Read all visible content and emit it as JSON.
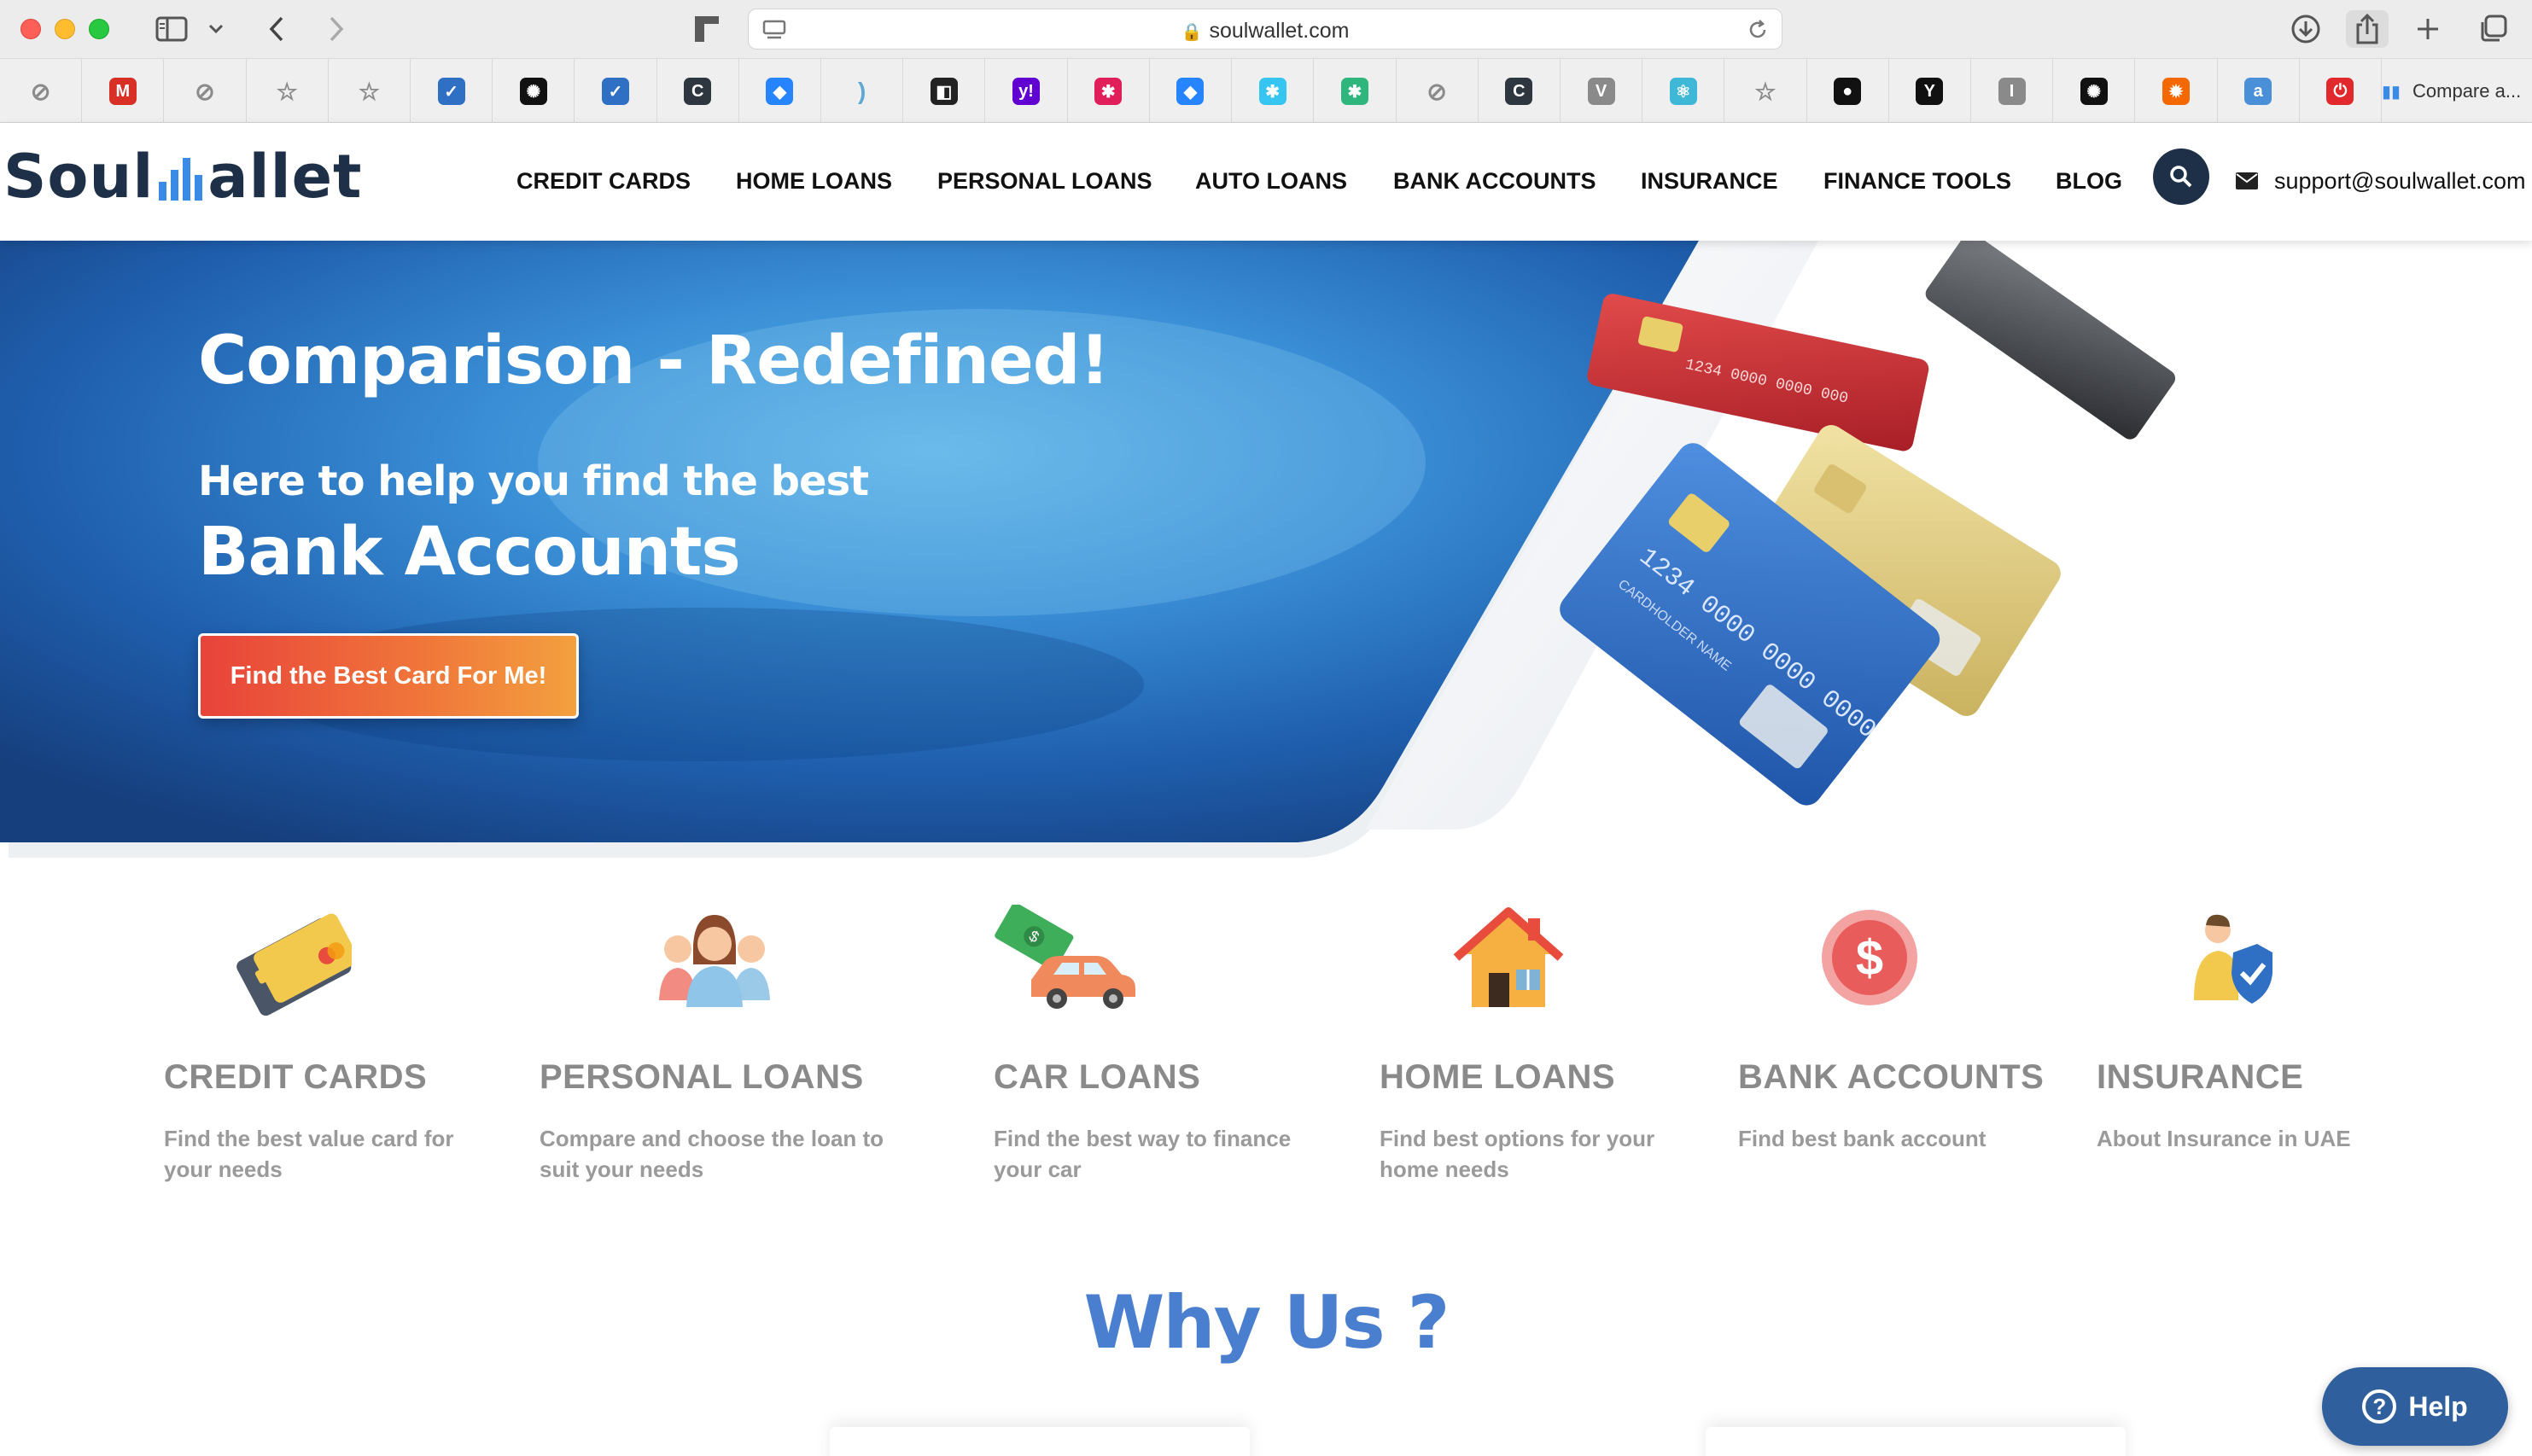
{
  "browser": {
    "url": "soulwallet.com",
    "last_bookmark": "Compare a...",
    "bookmarks": [
      {
        "icon": "safari-compass-icon",
        "color": "#8a8a8a",
        "glyph": "⊘"
      },
      {
        "icon": "gmail-icon",
        "color": "#d93025",
        "glyph": "M"
      },
      {
        "icon": "safari-compass-icon",
        "color": "#8a8a8a",
        "glyph": "⊘"
      },
      {
        "icon": "star-icon",
        "color": "#8a8a8a",
        "glyph": "☆"
      },
      {
        "icon": "star-icon",
        "color": "#8a8a8a",
        "glyph": "☆"
      },
      {
        "icon": "checkbox-app-icon",
        "color": "#2f6fc4",
        "glyph": "✓"
      },
      {
        "icon": "openai-icon",
        "color": "#111111",
        "glyph": "✺"
      },
      {
        "icon": "checkbox-app-icon",
        "color": "#2f6fc4",
        "glyph": "✓"
      },
      {
        "icon": "refresh-app-icon",
        "color": "#2e3640",
        "glyph": "C"
      },
      {
        "icon": "jira-icon",
        "color": "#2684ff",
        "glyph": "◆"
      },
      {
        "icon": "arc-icon",
        "color": "#5fa8d3",
        "glyph": ")"
      },
      {
        "icon": "notion-icon",
        "color": "#222222",
        "glyph": "◧"
      },
      {
        "icon": "yahoo-icon",
        "color": "#6001d2",
        "glyph": "y!"
      },
      {
        "icon": "slack-icon",
        "color": "#e01e5a",
        "glyph": "✱"
      },
      {
        "icon": "jira-icon",
        "color": "#2684ff",
        "glyph": "◆"
      },
      {
        "icon": "slack-icon",
        "color": "#36c5f0",
        "glyph": "✱"
      },
      {
        "icon": "slack-icon",
        "color": "#2eb67d",
        "glyph": "✱"
      },
      {
        "icon": "safari-compass-icon",
        "color": "#8a8a8a",
        "glyph": "⊘"
      },
      {
        "icon": "refresh-app-icon",
        "color": "#2e3640",
        "glyph": "C"
      },
      {
        "icon": "v-app-icon",
        "color": "#8a8a8a",
        "glyph": "V"
      },
      {
        "icon": "react-icon",
        "color": "#3fb7d6",
        "glyph": "⚛"
      },
      {
        "icon": "star-icon",
        "color": "#8a8a8a",
        "glyph": "☆"
      },
      {
        "icon": "github-icon",
        "color": "#111111",
        "glyph": "●"
      },
      {
        "icon": "ycombinator-icon",
        "color": "#111111",
        "glyph": "Y"
      },
      {
        "icon": "i-app-icon",
        "color": "#8a8a8a",
        "glyph": "I"
      },
      {
        "icon": "openai-icon",
        "color": "#111111",
        "glyph": "✺"
      },
      {
        "icon": "grafana-icon",
        "color": "#f46800",
        "glyph": "✹"
      },
      {
        "icon": "aster-icon",
        "color": "#4a90d9",
        "glyph": "a"
      },
      {
        "icon": "power-app-icon",
        "color": "#e0282d",
        "glyph": "⏻"
      }
    ]
  },
  "header": {
    "logo_left": "Soul",
    "logo_right": "allet",
    "nav": [
      "CREDIT CARDS",
      "HOME LOANS",
      "PERSONAL LOANS",
      "AUTO LOANS",
      "BANK ACCOUNTS",
      "INSURANCE",
      "FINANCE TOOLS",
      "BLOG"
    ],
    "email": "support@soulwallet.com"
  },
  "hero": {
    "title": "Comparison - Redefined!",
    "subtitle": "Here to help you find the best",
    "highlight": "Bank Accounts",
    "cta": "Find the Best Card For Me!",
    "card_numbers": [
      "1234 0000 0000 0000",
      "1234 0000 0000 000"
    ],
    "card_holder": "CARDHOLDER NAME"
  },
  "features": [
    {
      "title": "CREDIT CARDS",
      "desc": "Find the best value card for your needs",
      "icon": "credit-cards-icon"
    },
    {
      "title": "PERSONAL LOANS",
      "desc": "Compare and choose the loan to suit your needs",
      "icon": "people-icon"
    },
    {
      "title": "CAR LOANS",
      "desc": "Find the best way to finance your car",
      "icon": "car-money-icon"
    },
    {
      "title": "HOME LOANS",
      "desc": "Find best options for your home needs",
      "icon": "house-icon"
    },
    {
      "title": "BANK ACCOUNTS",
      "desc": "Find best bank account",
      "icon": "dollar-coin-icon"
    },
    {
      "title": "INSURANCE",
      "desc": "About Insurance in UAE",
      "icon": "insurance-shield-icon"
    }
  ],
  "why_us": "Why Us ?",
  "help_label": "Help",
  "colors": {
    "brand_navy": "#1e3048",
    "brand_blue": "#3a8be6",
    "hero_blue": "#1f5fae",
    "cta_start": "#e8433a",
    "cta_end": "#f3a03f",
    "why_blue": "#4a7fd0",
    "help_bg": "#2f5f9d"
  }
}
